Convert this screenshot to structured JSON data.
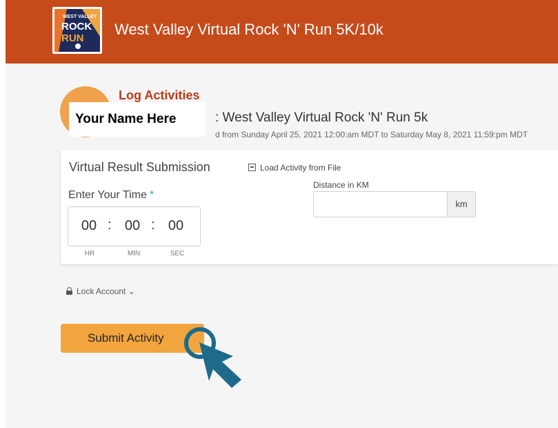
{
  "header": {
    "logo_text": "WEST VALLEY VIRTUAL ROCK 'N' RUN",
    "title": "West Valley Virtual Rock 'N' Run 5K/10k"
  },
  "page": {
    "heading": "Log Activities",
    "name_placeholder": "Your Name Here",
    "event_name": ": West Valley Virtual Rock 'N' Run 5k",
    "event_dates": "d from Sunday April 25, 2021 12:00:am MDT to Saturday May 8, 2021 11:59:pm MDT"
  },
  "form": {
    "title": "Virtual Result Submission",
    "load_file_label": "Load Activity from File",
    "time_label": "Enter Your Time",
    "required_mark": "*",
    "time": {
      "hours": "00",
      "minutes": "00",
      "seconds": "00"
    },
    "time_units": {
      "hr": "HR",
      "min": "MIN",
      "sec": "SEC"
    },
    "colon": ":",
    "distance_label": "Distance in KM",
    "distance_value": "",
    "distance_unit": "km"
  },
  "lock_account": {
    "label": "Lock Account",
    "chevron": "⌄"
  },
  "submit": {
    "label": "Submit Activity"
  },
  "colors": {
    "header": "#c54b1b",
    "accent_orange": "#f2a53f",
    "heading_red": "#b83c17",
    "cursor_teal": "#1e6a8a"
  },
  "icons": [
    "logo-icon",
    "file-icon",
    "lock-icon",
    "chevron-down-icon",
    "pointer-cursor-icon"
  ]
}
